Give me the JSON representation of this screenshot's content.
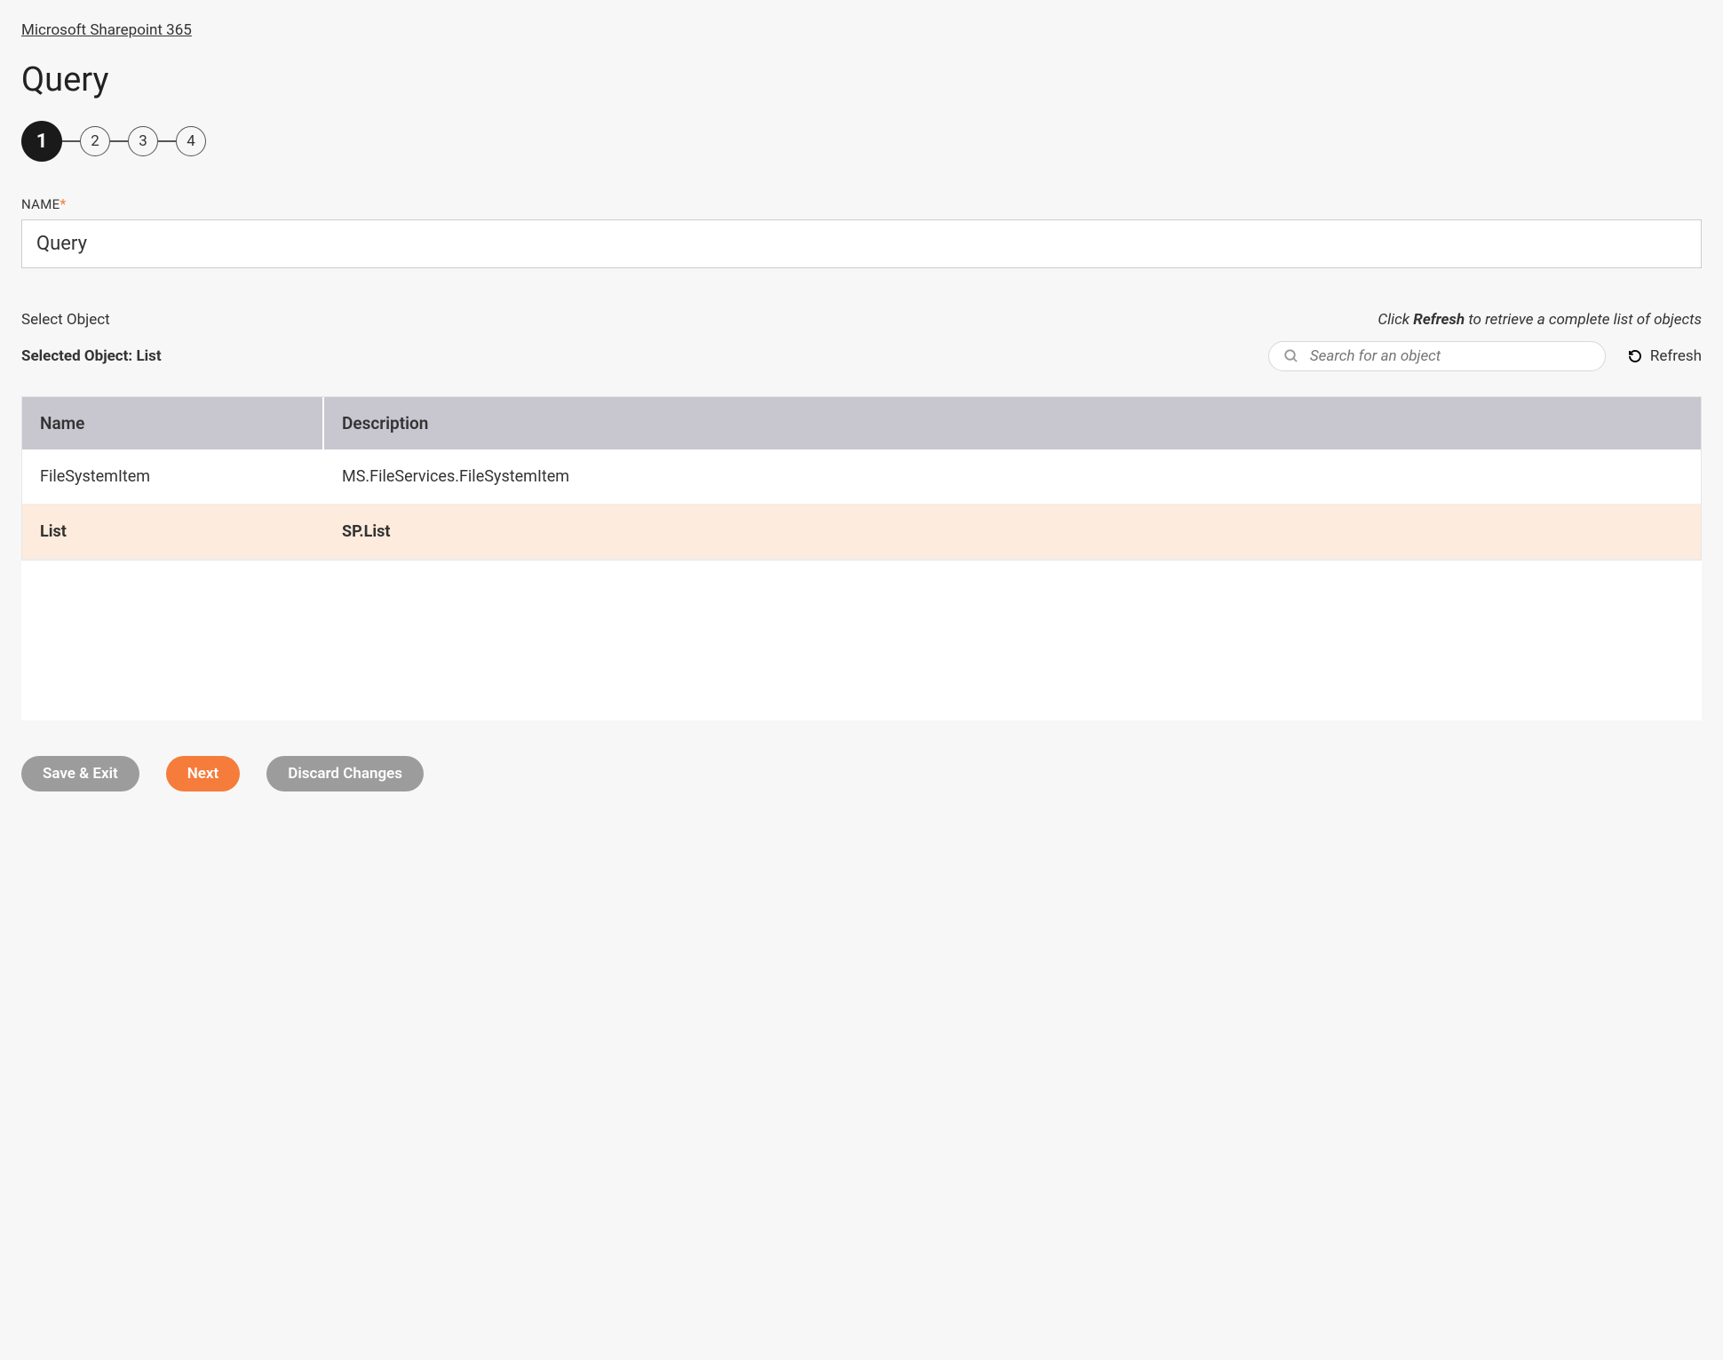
{
  "breadcrumb": "Microsoft Sharepoint 365",
  "page_title": "Query",
  "stepper": {
    "steps": [
      "1",
      "2",
      "3",
      "4"
    ],
    "active_index": 0
  },
  "name_field": {
    "label": "NAME",
    "value": "Query"
  },
  "select_object": {
    "title": "Select Object",
    "hint_prefix": "Click ",
    "hint_bold": "Refresh",
    "hint_suffix": " to retrieve a complete list of objects",
    "selected_prefix": "Selected Object: ",
    "selected_value": "List",
    "search_placeholder": "Search for an object",
    "refresh_label": "Refresh"
  },
  "table": {
    "headers": {
      "name": "Name",
      "description": "Description"
    },
    "rows": [
      {
        "name": "FileSystemItem",
        "description": "MS.FileServices.FileSystemItem",
        "selected": false
      },
      {
        "name": "List",
        "description": "SP.List",
        "selected": true
      }
    ]
  },
  "buttons": {
    "save": "Save & Exit",
    "next": "Next",
    "discard": "Discard Changes"
  }
}
